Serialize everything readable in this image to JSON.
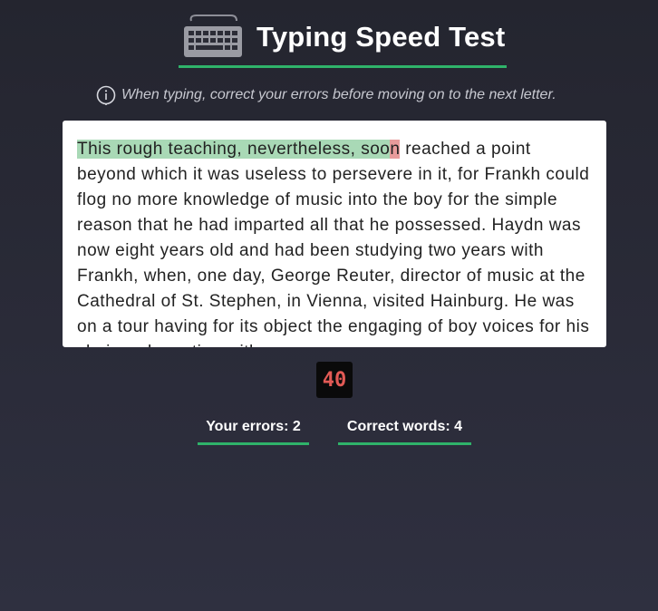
{
  "header": {
    "title": "Typing Speed Test",
    "icon": "keyboard-icon"
  },
  "hint": {
    "icon": "info-icon",
    "text": "When typing, correct your errors before moving on to the next letter."
  },
  "passage": {
    "typed_correct": "This rough teaching, nevertheless, soo",
    "typed_error": "n",
    "remaining": " reached a point beyond which it was useless to persevere in it, for Frankh could flog no more knowledge of music into the boy for the simple reason that he had imparted all that he possessed. Haydn was now eight years old and had been studying two years with Frankh, when, one day, George Reuter, director of music at the Cathedral of St. Stephen, in Vienna, visited Hainburg. He was on a tour having for its object the engaging of boy voices for his choir and meeting with"
  },
  "timer": {
    "value": "40"
  },
  "stats": {
    "errors_label": "Your errors: 2",
    "correct_words_label": "Correct words: 4"
  },
  "colors": {
    "accent": "#2fb36a",
    "correct_highlight": "#a9d9b6",
    "error_highlight": "#e89b9b",
    "timer_text": "#e25a55"
  }
}
